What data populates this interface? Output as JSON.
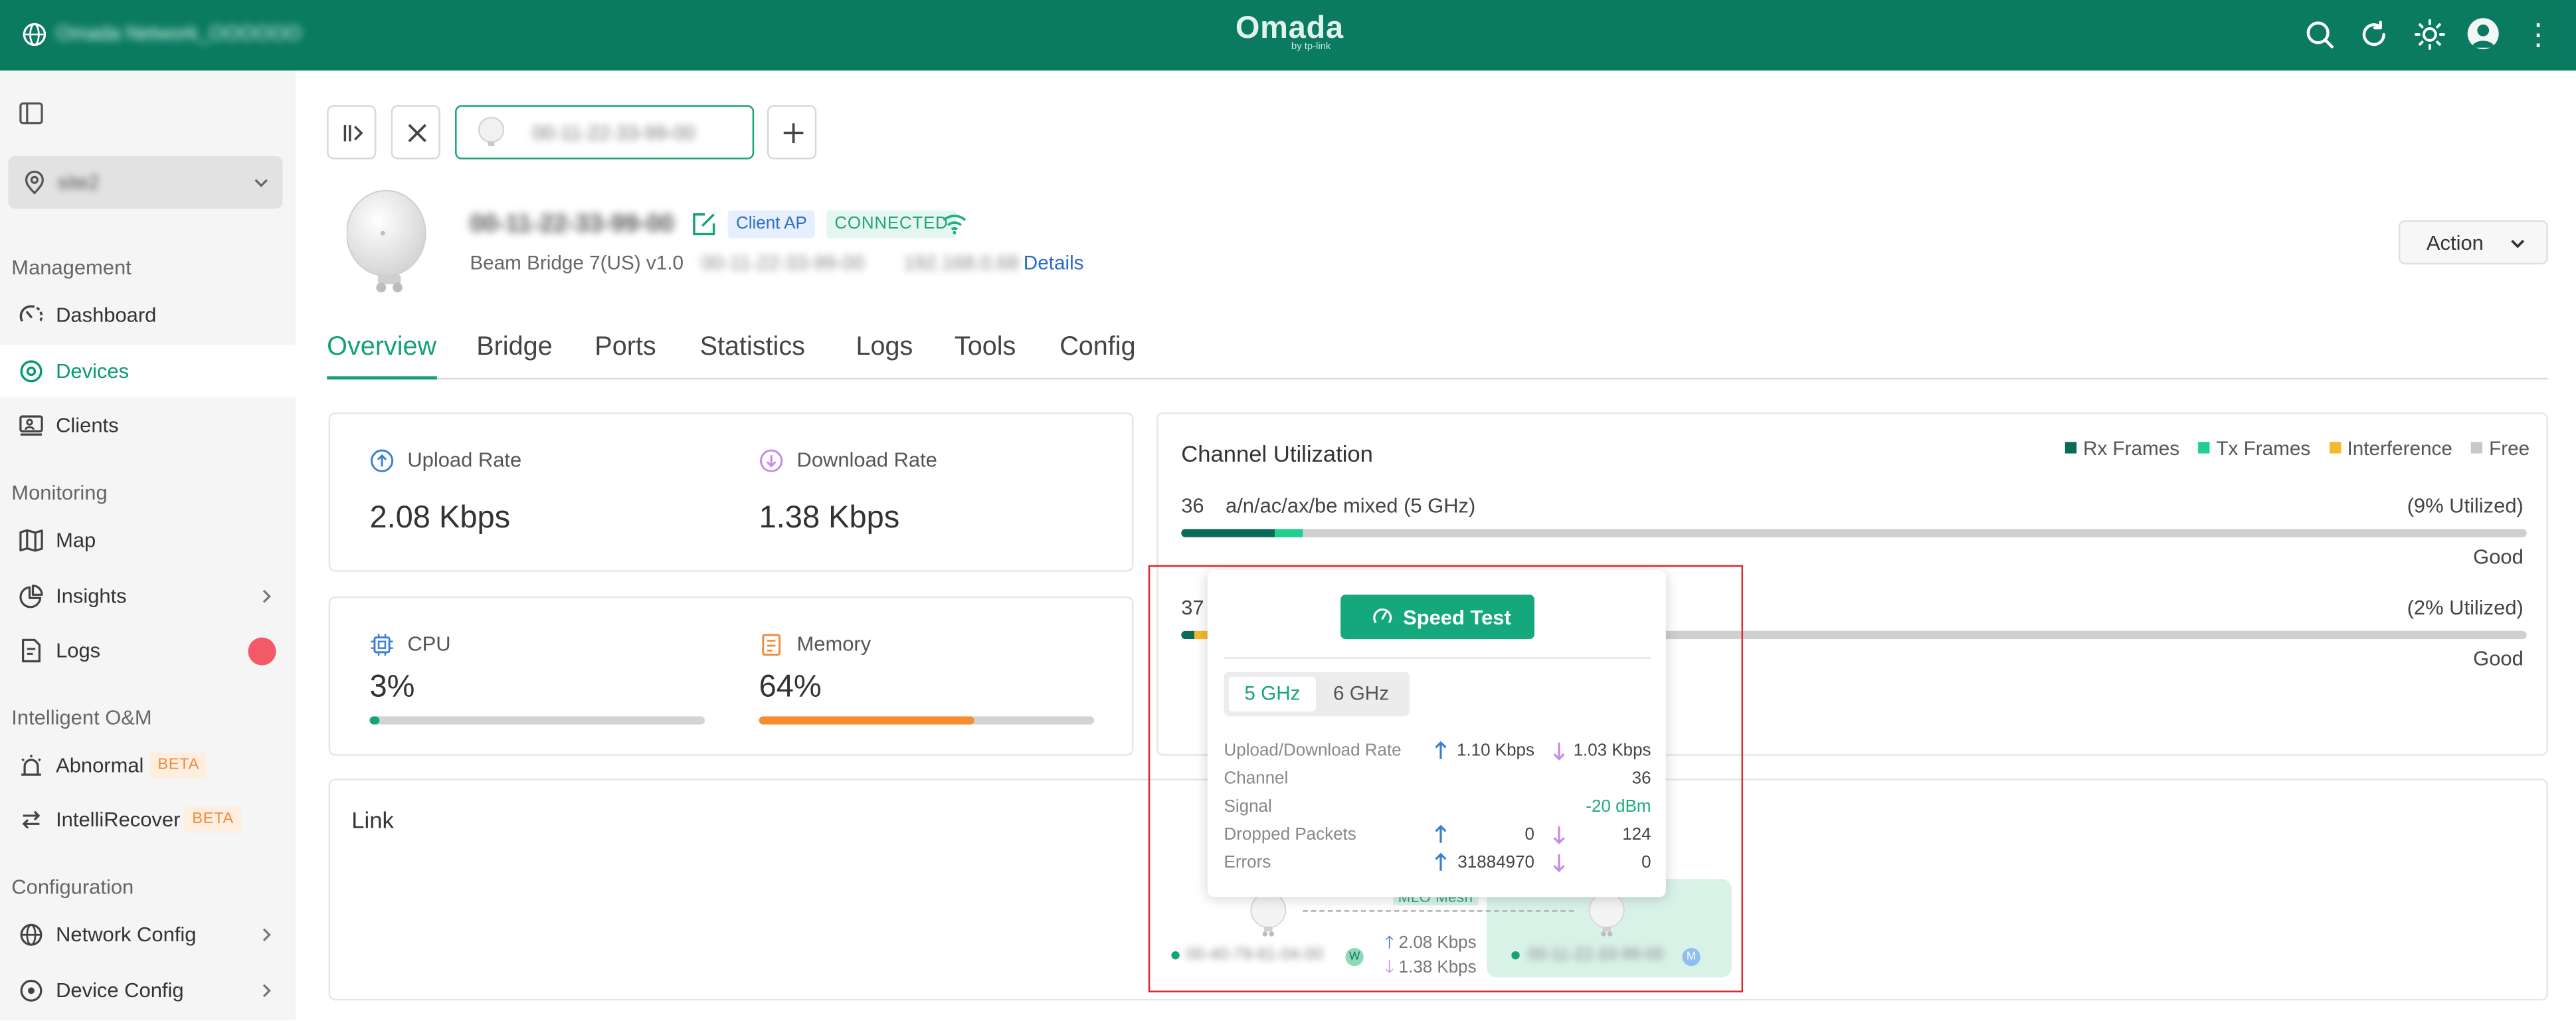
{
  "topbar": {
    "network_name": "Omada Network_OOOOOO",
    "brand": "Omada",
    "brand_sub": "by tp-link"
  },
  "sidebar": {
    "site": "site2",
    "sections": {
      "management": "Management",
      "monitoring": "Monitoring",
      "intelligent": "Intelligent O&M",
      "configuration": "Configuration"
    },
    "items": {
      "dashboard": "Dashboard",
      "devices": "Devices",
      "clients": "Clients",
      "map": "Map",
      "insights": "Insights",
      "logs": "Logs",
      "abnormal": "Abnormal",
      "intellirecover": "IntelliRecover",
      "network_config": "Network Config",
      "device_config": "Device Config"
    },
    "beta": "BETA"
  },
  "device_tab": {
    "mac": "00-11-22-33-99-00"
  },
  "device": {
    "name": "00-11-22-33-99-00",
    "tag_client": "Client AP",
    "tag_connected": "CONNECTED",
    "model": "Beam Bridge 7(US) v1.0",
    "mac": "00-11-22-33-99-00",
    "ip": "192.168.0.68",
    "details": "Details",
    "action": "Action"
  },
  "tabs": [
    "Overview",
    "Bridge",
    "Ports",
    "Statistics",
    "Logs",
    "Tools",
    "Config"
  ],
  "stats": {
    "upload_label": "Upload Rate",
    "upload_value": "2.08 Kbps",
    "download_label": "Download Rate",
    "download_value": "1.38 Kbps",
    "cpu_label": "CPU",
    "cpu_value": "3%",
    "cpu_fraction": 0.03,
    "memory_label": "Memory",
    "memory_value": "64%",
    "memory_fraction": 0.64
  },
  "channel_util": {
    "title": "Channel Utilization",
    "legend": [
      "Rx Frames",
      "Tx Frames",
      "Interference",
      "Free"
    ],
    "colors": {
      "rx": "#0b6b5a",
      "tx": "#1fcf8e",
      "interference": "#f5b82e",
      "free": "#c8c8c8"
    },
    "rows": [
      {
        "channel": "36",
        "mode": "a/n/ac/ax/be mixed  (5 GHz)",
        "utilized": "(9% Utilized)",
        "quality": "Good",
        "rx": 0.07,
        "tx": 0.02,
        "interference": 0
      },
      {
        "channel": "37",
        "mode": "",
        "utilized": "(2% Utilized)",
        "quality": "Good",
        "rx": 0.01,
        "tx": 0,
        "interference": 0.01
      }
    ]
  },
  "link": {
    "title": "Link"
  },
  "popover": {
    "speed_test": "Speed Test",
    "bands": [
      "5 GHz",
      "6 GHz"
    ],
    "rows": {
      "rate_label": "Upload/Download Rate",
      "rate_up": "1.10 Kbps",
      "rate_down": "1.03 Kbps",
      "channel_label": "Channel",
      "channel_value": "36",
      "signal_label": "Signal",
      "signal_value": "-20 dBm",
      "dropped_label": "Dropped Packets",
      "dropped_up": "0",
      "dropped_down": "124",
      "errors_label": "Errors",
      "errors_up": "31884970",
      "errors_down": "0"
    }
  },
  "mesh": {
    "label": "MLO Mesh",
    "left_mac": "00-40-79-81-04-00",
    "left_badge": "W",
    "right_mac": "00-11-22-33-99-00",
    "right_badge": "M",
    "up_rate": "2.08 Kbps",
    "down_rate": "1.38 Kbps"
  }
}
